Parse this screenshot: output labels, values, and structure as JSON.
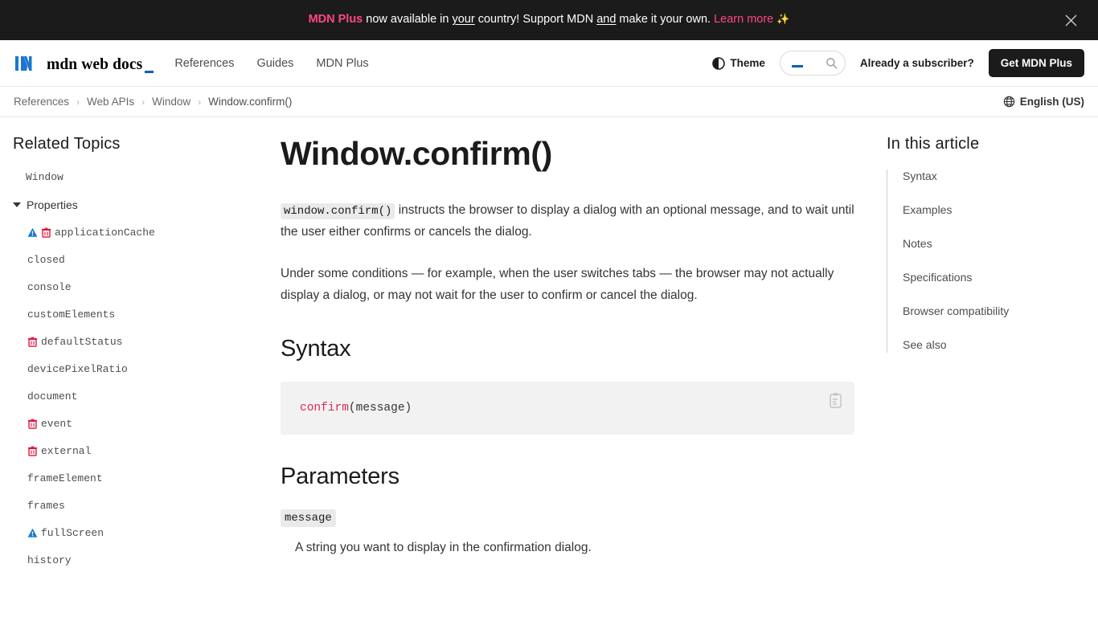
{
  "promo": {
    "brand": "MDN Plus",
    "text_1": " now available in ",
    "underline_1": "your",
    "text_2": " country! Support MDN ",
    "underline_2": "and",
    "text_3": " make it your own. ",
    "link": "Learn more",
    "sparkle": "✨",
    "close_icon": "close-icon"
  },
  "header": {
    "logo_text": "mdn web docs",
    "logo_icon": "mdn-logo-icon",
    "nav": [
      {
        "label": "References"
      },
      {
        "label": "Guides"
      },
      {
        "label": "MDN Plus"
      }
    ],
    "theme_label": "Theme",
    "theme_icon": "contrast-theme-icon",
    "search_icon": "search-icon",
    "search_value": "",
    "search_placeholder": "",
    "subscriber_label": "Already a subscriber?",
    "cta_label": "Get MDN Plus"
  },
  "breadcrumb": {
    "items": [
      {
        "label": "References"
      },
      {
        "label": "Web APIs"
      },
      {
        "label": "Window"
      },
      {
        "label": "Window.confirm()"
      }
    ],
    "separator": "›",
    "language": "English (US)",
    "globe_icon": "globe-icon"
  },
  "sidebar": {
    "title": "Related Topics",
    "root_item": "Window",
    "group_label": "Properties",
    "group_caret_icon": "chevron-down-icon",
    "items": [
      {
        "label": "applicationCache",
        "badges": [
          "experimental-icon",
          "deprecated-icon"
        ]
      },
      {
        "label": "closed",
        "badges": []
      },
      {
        "label": "console",
        "badges": []
      },
      {
        "label": "customElements",
        "badges": []
      },
      {
        "label": "defaultStatus",
        "badges": [
          "deprecated-icon"
        ]
      },
      {
        "label": "devicePixelRatio",
        "badges": []
      },
      {
        "label": "document",
        "badges": []
      },
      {
        "label": "event",
        "badges": [
          "deprecated-icon"
        ]
      },
      {
        "label": "external",
        "badges": [
          "deprecated-icon"
        ]
      },
      {
        "label": "frameElement",
        "badges": []
      },
      {
        "label": "frames",
        "badges": []
      },
      {
        "label": "fullScreen",
        "badges": [
          "experimental-icon"
        ]
      },
      {
        "label": "history",
        "badges": []
      }
    ]
  },
  "article": {
    "title": "Window.confirm()",
    "intro_code": "window.confirm()",
    "intro_rest": " instructs the browser to display a dialog with an optional message, and to wait until the user either confirms or cancels the dialog.",
    "paragraph_2": "Under some conditions — for example, when the user switches tabs — the browser may not actually display a dialog, or may not wait for the user to confirm or cancel the dialog.",
    "syntax_heading": "Syntax",
    "code_fn": "confirm",
    "code_args": "(message)",
    "copy_icon": "copy-to-clipboard-icon",
    "parameters_heading": "Parameters",
    "param_name": "message",
    "param_desc": "A string you want to display in the confirmation dialog."
  },
  "toc": {
    "title": "In this article",
    "items": [
      {
        "label": "Syntax"
      },
      {
        "label": "Examples"
      },
      {
        "label": "Notes"
      },
      {
        "label": "Specifications"
      },
      {
        "label": "Browser compatibility"
      },
      {
        "label": "See also"
      }
    ]
  },
  "colors": {
    "banner_bg": "#1b1b1b",
    "brand_pink": "#ff4588",
    "accent_blue": "#0b5eb5",
    "code_red": "#d72d5a",
    "deprecated_red": "#e1123f",
    "experimental_blue": "#1b76d1"
  }
}
